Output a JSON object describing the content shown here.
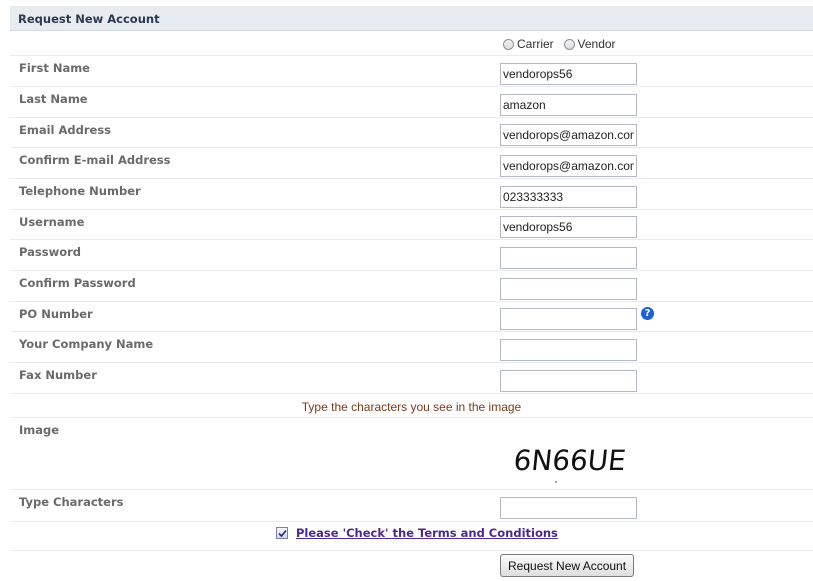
{
  "form_title": "Request New Account",
  "account_type": {
    "options": [
      {
        "label": "Carrier",
        "selected": false
      },
      {
        "label": "Vendor",
        "selected": false
      }
    ]
  },
  "fields": {
    "first_name": {
      "label": "First Name",
      "value": "vendorops56"
    },
    "last_name": {
      "label": "Last Name",
      "value": "amazon"
    },
    "email": {
      "label": "Email Address",
      "value": "vendorops@amazon.com"
    },
    "confirm_email": {
      "label": "Confirm E-mail Address",
      "value": "vendorops@amazon.com"
    },
    "telephone": {
      "label": "Telephone Number",
      "value": "023333333"
    },
    "username": {
      "label": "Username",
      "value": "vendorops56"
    },
    "password": {
      "label": "Password",
      "value": ""
    },
    "confirm_password": {
      "label": "Confirm Password",
      "value": ""
    },
    "po_number": {
      "label": "PO Number",
      "value": ""
    },
    "company_name": {
      "label": "Your Company Name",
      "value": ""
    },
    "fax_number": {
      "label": "Fax Number",
      "value": ""
    }
  },
  "captcha": {
    "hint": "Type the characters you see in the image",
    "image_label": "Image",
    "image_text": "6N66UE",
    "input_label": "Type Characters",
    "input_value": ""
  },
  "terms": {
    "checked": true,
    "link_text": "Please 'Check' the Terms and Conditions"
  },
  "submit_label": "Request New Account",
  "colors": {
    "header_bg": "#e8ecf1",
    "link": "#4b2a8a",
    "help_icon": "#1e5fd6",
    "hint_text": "#7a3b1a"
  }
}
